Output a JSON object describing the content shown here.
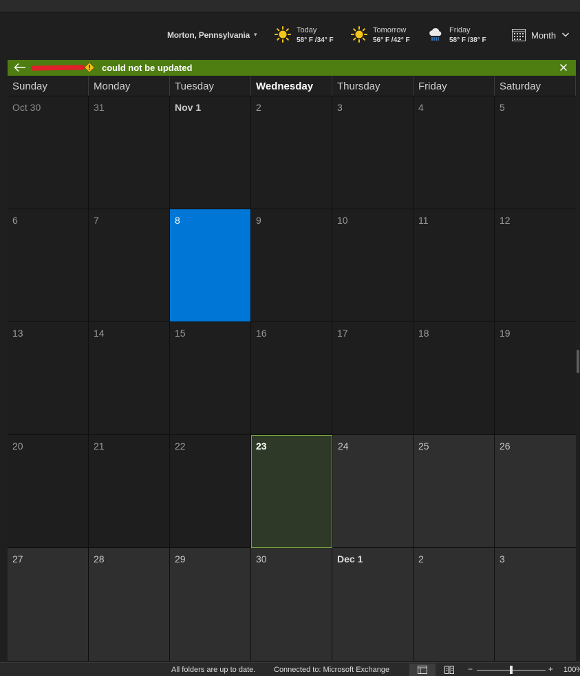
{
  "weather": {
    "location": "Morton, Pennsylvania",
    "today": {
      "label": "Today",
      "temps": "58° F /34° F",
      "icon": "sun-icon"
    },
    "tomorrow": {
      "label": "Tomorrow",
      "temps": "56° F /42° F",
      "icon": "sun-icon"
    },
    "friday": {
      "label": "Friday",
      "temps": "58° F /38° F",
      "icon": "rain-cloud-icon"
    }
  },
  "view": {
    "label": "Month"
  },
  "infobar": {
    "message": "could not be updated",
    "color": "#4e7d12"
  },
  "calendar": {
    "weekdays": [
      "Sunday",
      "Monday",
      "Tuesday",
      "Wednesday",
      "Thursday",
      "Friday",
      "Saturday"
    ],
    "weeks": [
      [
        "Oct 30",
        "31",
        "Nov 1",
        "2",
        "3",
        "4",
        "5"
      ],
      [
        "6",
        "7",
        "8",
        "9",
        "10",
        "11",
        "12"
      ],
      [
        "13",
        "14",
        "15",
        "16",
        "17",
        "18",
        "19"
      ],
      [
        "20",
        "21",
        "22",
        "23",
        "24",
        "25",
        "26"
      ],
      [
        "27",
        "28",
        "29",
        "30",
        "Dec 1",
        "2",
        "3"
      ]
    ],
    "selected_color": "#0077d6",
    "today_color": "#7aa63c"
  },
  "status": {
    "sync": "All folders are up to date.",
    "connection": "Connected to: Microsoft Exchange",
    "zoom_minus": "−",
    "zoom_plus": "+",
    "zoom_level": "100%"
  }
}
